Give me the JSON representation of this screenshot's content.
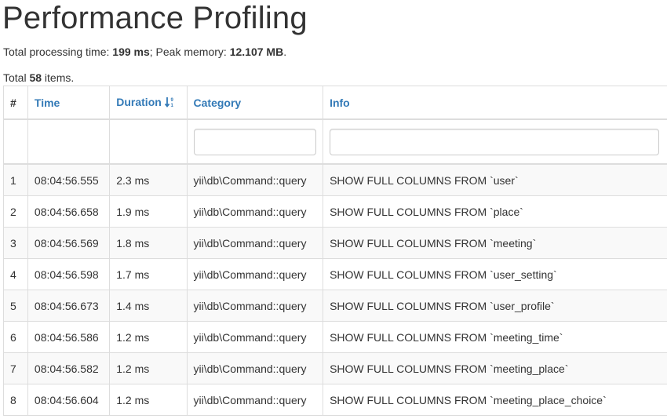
{
  "page_title": "Performance Profiling",
  "summary": {
    "time_label": "Total processing time: ",
    "time_value": "199 ms",
    "sep": "; Peak memory: ",
    "memory_value": "12.107 MB",
    "end": "."
  },
  "total": {
    "prefix": "Total ",
    "count": "58",
    "suffix": " items."
  },
  "table": {
    "headers": {
      "num": "#",
      "time": "Time",
      "duration": "Duration",
      "category": "Category",
      "info": "Info"
    },
    "filters": {
      "category_value": "",
      "info_value": ""
    },
    "rows": [
      {
        "num": "1",
        "time": "08:04:56.555",
        "duration": "2.3 ms",
        "category": "yii\\db\\Command::query",
        "info": "SHOW FULL COLUMNS FROM `user`"
      },
      {
        "num": "2",
        "time": "08:04:56.658",
        "duration": "1.9 ms",
        "category": "yii\\db\\Command::query",
        "info": "SHOW FULL COLUMNS FROM `place`"
      },
      {
        "num": "3",
        "time": "08:04:56.569",
        "duration": "1.8 ms",
        "category": "yii\\db\\Command::query",
        "info": "SHOW FULL COLUMNS FROM `meeting`"
      },
      {
        "num": "4",
        "time": "08:04:56.598",
        "duration": "1.7 ms",
        "category": "yii\\db\\Command::query",
        "info": "SHOW FULL COLUMNS FROM `user_setting`"
      },
      {
        "num": "5",
        "time": "08:04:56.673",
        "duration": "1.4 ms",
        "category": "yii\\db\\Command::query",
        "info": "SHOW FULL COLUMNS FROM `user_profile`"
      },
      {
        "num": "6",
        "time": "08:04:56.586",
        "duration": "1.2 ms",
        "category": "yii\\db\\Command::query",
        "info": "SHOW FULL COLUMNS FROM `meeting_time`"
      },
      {
        "num": "7",
        "time": "08:04:56.582",
        "duration": "1.2 ms",
        "category": "yii\\db\\Command::query",
        "info": "SHOW FULL COLUMNS FROM `meeting_place`"
      },
      {
        "num": "8",
        "time": "08:04:56.604",
        "duration": "1.2 ms",
        "category": "yii\\db\\Command::query",
        "info": "SHOW FULL COLUMNS FROM `meeting_place_choice`"
      }
    ]
  },
  "colors": {
    "link": "#337ab7",
    "text": "#333333",
    "border": "#dddddd",
    "stripe": "#f9f9f9"
  },
  "icons": {
    "duration_sort": "sort-numeric-desc-icon"
  }
}
